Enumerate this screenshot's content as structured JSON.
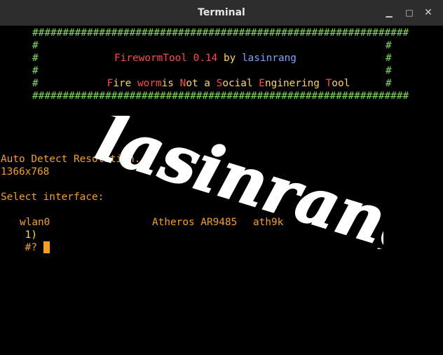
{
  "window": {
    "title": "Terminal",
    "minimize_glyph": "▁",
    "maximize_glyph": "□",
    "close_glyph": "✕"
  },
  "banner": {
    "border": "##############################################################",
    "side": "#",
    "tool_name": "FirewormTool 0.14",
    "by": "by",
    "author": "lasinrang",
    "tagline_segments": [
      {
        "text": "F",
        "color": "red"
      },
      {
        "text": "ire ",
        "color": "yellow"
      },
      {
        "text": "worm",
        "color": "red"
      },
      {
        "text": "is ",
        "color": "yellow"
      },
      {
        "text": "N",
        "color": "red"
      },
      {
        "text": "ot a ",
        "color": "yellow"
      },
      {
        "text": "S",
        "color": "red"
      },
      {
        "text": "ocial ",
        "color": "yellow"
      },
      {
        "text": "E",
        "color": "red"
      },
      {
        "text": "nginering ",
        "color": "yellow"
      },
      {
        "text": "T",
        "color": "red"
      },
      {
        "text": "ool",
        "color": "yellow"
      }
    ]
  },
  "watermark": {
    "text": "lasinrang"
  },
  "output": {
    "auto_detect": "Auto Detect Resolution...",
    "resolution": "1366x768",
    "select_prompt": "Select interface:",
    "interface": {
      "index": "1)",
      "name": "wlan0",
      "chipset": "Atheros AR9485",
      "driver": "ath9k"
    },
    "prompt": "#?"
  },
  "colors": {
    "green": "#7fd95a",
    "red": "#ff4a4a",
    "blue": "#7ea6ff",
    "yellow": "#ffd84d",
    "orange": "#f5a020"
  }
}
